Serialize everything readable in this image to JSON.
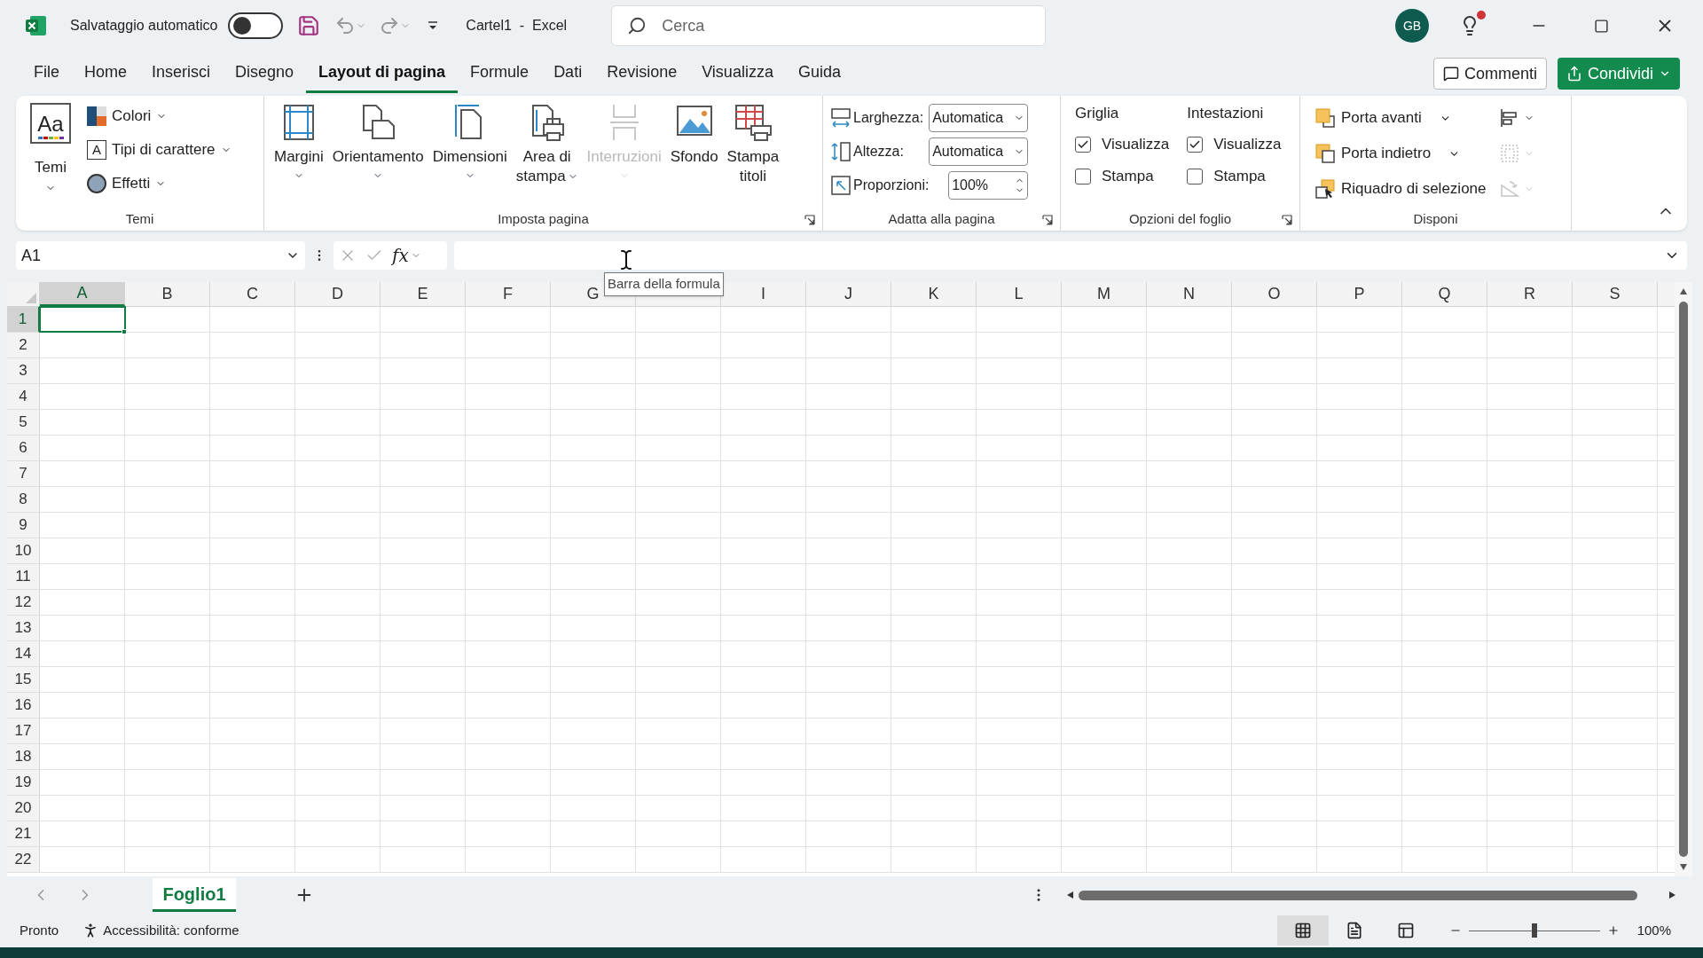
{
  "title_bar": {
    "autosave": {
      "label": "Salvataggio automatico",
      "on": false
    },
    "document_title": "Cartel1  -  Excel",
    "search_placeholder": "Cerca",
    "avatar_initials": "GB",
    "tips_notification": true
  },
  "menu_tabs": [
    {
      "label": "File",
      "selected": false
    },
    {
      "label": "Home",
      "selected": false
    },
    {
      "label": "Inserisci",
      "selected": false
    },
    {
      "label": "Disegno",
      "selected": false
    },
    {
      "label": "Layout di pagina",
      "selected": true
    },
    {
      "label": "Formule",
      "selected": false
    },
    {
      "label": "Dati",
      "selected": false
    },
    {
      "label": "Revisione",
      "selected": false
    },
    {
      "label": "Visualizza",
      "selected": false
    },
    {
      "label": "Guida",
      "selected": false
    }
  ],
  "actions": {
    "comments": "Commenti",
    "share": "Condividi"
  },
  "ribbon": {
    "themes_group": {
      "label": "Temi",
      "main": {
        "label": "Temi",
        "icon_text": "Aa"
      },
      "small": [
        {
          "label": "Colori"
        },
        {
          "label": "Tipi di carattere",
          "icon_text": "A"
        },
        {
          "label": "Effetti"
        }
      ]
    },
    "page_setup_group": {
      "label": "Imposta pagina",
      "buttons": [
        {
          "lines": [
            "Margini"
          ],
          "menu": true,
          "disabled": false
        },
        {
          "lines": [
            "Orientamento"
          ],
          "menu": true,
          "disabled": false
        },
        {
          "lines": [
            "Dimensioni"
          ],
          "menu": true,
          "disabled": false
        },
        {
          "lines": [
            "Area di",
            "stampa"
          ],
          "menu": true,
          "disabled": false
        },
        {
          "lines": [
            "Interruzioni"
          ],
          "menu": true,
          "disabled": true
        },
        {
          "lines": [
            "Sfondo"
          ],
          "menu": false,
          "disabled": false
        },
        {
          "lines": [
            "Stampa",
            "titoli"
          ],
          "menu": false,
          "disabled": false
        }
      ]
    },
    "scale_group": {
      "label": "Adatta alla pagina",
      "rows": [
        {
          "label": "Larghezza:",
          "value": "Automatica",
          "kind": "dropdown"
        },
        {
          "label": "Altezza:",
          "value": "Automatica",
          "kind": "dropdown"
        },
        {
          "label": "Proporzioni:",
          "value": "100%",
          "kind": "spinner"
        }
      ]
    },
    "sheet_options_group": {
      "label": "Opzioni del foglio",
      "sections": [
        {
          "title": "Griglia",
          "options": [
            {
              "label": "Visualizza",
              "checked": true
            },
            {
              "label": "Stampa",
              "checked": false
            }
          ]
        },
        {
          "title": "Intestazioni",
          "options": [
            {
              "label": "Visualizza",
              "checked": true
            },
            {
              "label": "Stampa",
              "checked": false
            }
          ]
        }
      ]
    },
    "arrange_group": {
      "label": "Disponi",
      "buttons": [
        {
          "label": "Porta avanti",
          "menu": true
        },
        {
          "label": "Porta indietro",
          "menu": true
        },
        {
          "label": "Riquadro di selezione",
          "menu": false
        }
      ],
      "icon_buttons": [
        {
          "disabled": false
        },
        {
          "disabled": true
        },
        {
          "disabled": true
        }
      ]
    }
  },
  "formula_bar": {
    "name_box": "A1",
    "function_label": "fx"
  },
  "tooltip": "Barra della formula",
  "grid": {
    "columns": [
      {
        "label": "A",
        "selected": true
      },
      {
        "label": "B",
        "selected": false
      },
      {
        "label": "C",
        "selected": false
      },
      {
        "label": "D",
        "selected": false
      },
      {
        "label": "E",
        "selected": false
      },
      {
        "label": "F",
        "selected": false
      },
      {
        "label": "G",
        "selected": false
      },
      {
        "selected": false
      },
      {
        "label": "I",
        "selected": false
      },
      {
        "label": "J",
        "selected": false
      },
      {
        "label": "K",
        "selected": false
      },
      {
        "label": "L",
        "selected": false
      },
      {
        "label": "M",
        "selected": false
      },
      {
        "label": "N",
        "selected": false
      },
      {
        "label": "O",
        "selected": false
      },
      {
        "label": "P",
        "selected": false
      },
      {
        "label": "Q",
        "selected": false
      },
      {
        "label": "R",
        "selected": false
      },
      {
        "label": "S",
        "selected": false
      }
    ],
    "rows": [
      {
        "label": "1",
        "selected": true
      },
      {
        "label": "2",
        "selected": false
      },
      {
        "label": "3",
        "selected": false
      },
      {
        "label": "4",
        "selected": false
      },
      {
        "label": "5",
        "selected": false
      },
      {
        "label": "6",
        "selected": false
      },
      {
        "label": "7",
        "selected": false
      },
      {
        "label": "8",
        "selected": false
      },
      {
        "label": "9",
        "selected": false
      },
      {
        "label": "10",
        "selected": false
      },
      {
        "label": "11",
        "selected": false
      },
      {
        "label": "12",
        "selected": false
      },
      {
        "label": "13",
        "selected": false
      },
      {
        "label": "14",
        "selected": false
      },
      {
        "label": "15",
        "selected": false
      },
      {
        "label": "16",
        "selected": false
      },
      {
        "label": "17",
        "selected": false
      },
      {
        "label": "18",
        "selected": false
      },
      {
        "label": "19",
        "selected": false
      },
      {
        "label": "20",
        "selected": false
      },
      {
        "label": "21",
        "selected": false
      },
      {
        "label": "22",
        "selected": false
      }
    ]
  },
  "sheet_tabs": [
    {
      "label": "Foglio1",
      "selected": true
    }
  ],
  "status_bar": {
    "mode": "Pronto",
    "accessibility": "Accessibilità: conforme",
    "views": [
      {
        "selected": true
      },
      {
        "selected": false
      },
      {
        "selected": false
      }
    ],
    "zoom": {
      "level": 0.5
    },
    "zoom_label": "100%"
  }
}
